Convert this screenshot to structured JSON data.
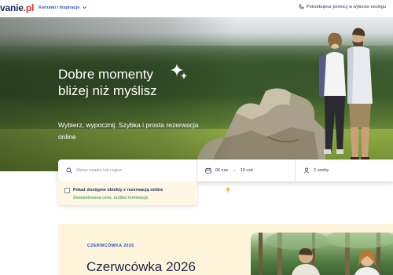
{
  "header": {
    "logo_main": "vanie",
    "logo_tld": ".pl",
    "nav_label": "Kierunki i Inspiracje",
    "help_text": "Potrzebujesz pomocy w wyborze noclegu"
  },
  "hero": {
    "title": "Dobre momenty\nbliżej niż myślisz",
    "subtitle": "Wybierz, wypocznij. Szybka i prosta rezerwacja online"
  },
  "search": {
    "where_placeholder": "Wpisz miasto lub region",
    "date_from": "06 cze",
    "date_arrow": "→",
    "date_to": "10 cze",
    "guests": "2 osoby"
  },
  "filter": {
    "checkbox_label": "Pokaż dostępne obiekty z rezerwacją online",
    "checkbox_checked": false,
    "note": "Gwarantowana cena, szybka rezerwacja"
  },
  "promo": {
    "eyebrow": "CZERWCÓWKA 2026",
    "title": "Czerwcówka 2026"
  },
  "colors": {
    "brand_navy": "#1b2e6b",
    "brand_red": "#e3312f",
    "link_blue": "#2a55c8",
    "success_green": "#2f8a3e",
    "promo_bg": "#fdf4db"
  }
}
